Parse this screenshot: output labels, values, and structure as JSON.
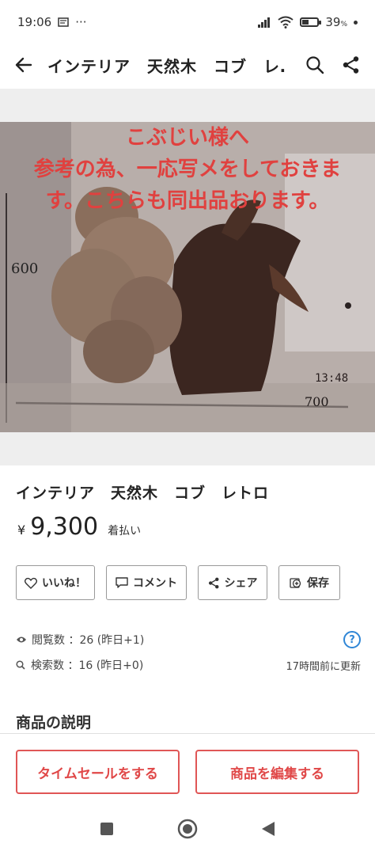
{
  "status_bar": {
    "time": "19:06",
    "dots": "···",
    "battery_pct": "39",
    "pct_sign": "%",
    "battery_level": 0.39
  },
  "app_bar": {
    "title": "インテリア　天然木　コブ　レ…",
    "back_icon": "arrow-left-icon",
    "search_icon": "search-icon",
    "share_icon": "share-icon"
  },
  "photo": {
    "overlay_lines": [
      "こぶじい様へ",
      "参考の為、一応写メをしておきま",
      "す。こちらも同出品おります。"
    ],
    "number_600": "600",
    "timestamp": "13:48",
    "number_700": "700"
  },
  "product": {
    "title": "インテリア　天然木　コブ　レトロ",
    "currency": "¥",
    "price": "9,300",
    "shipping": "着払い"
  },
  "actions": {
    "like": "いいね！",
    "comment": "コメント",
    "share": "シェア",
    "save": "保存"
  },
  "stats": {
    "views": "閲覧数 ：26 (昨日+1)",
    "searches": "検索数 ：16 (昨日+0)",
    "updated": "17時間前に更新",
    "help": "?"
  },
  "section": {
    "description_title": "商品の説明"
  },
  "bottom": {
    "time_sale": "タイムセールをする",
    "edit": "商品を編集する"
  },
  "colors": {
    "accent_red": "#e04848",
    "help_blue": "#2f86d6",
    "overlay_red": "#e0413f"
  }
}
